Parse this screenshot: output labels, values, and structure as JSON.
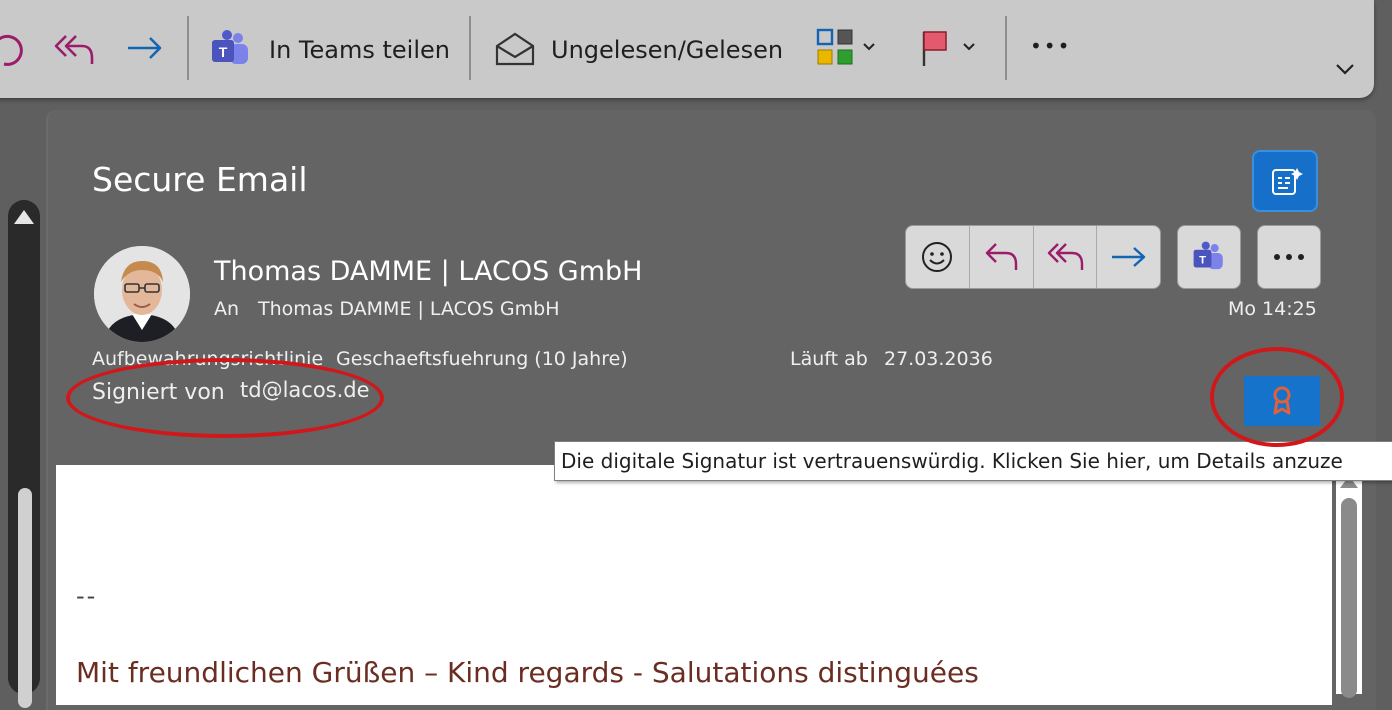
{
  "toolbar": {
    "teams_share_label": "In Teams teilen",
    "unread_read_label": "Ungelesen/Gelesen",
    "more_label": "•••"
  },
  "message": {
    "subject": "Secure Email",
    "sender": "Thomas DAMME | LACOS GmbH",
    "to_label": "An",
    "to_value": "Thomas DAMME | LACOS GmbH",
    "time": "Mo 14:25",
    "retention_label": "Aufbewahrungsrichtlinie",
    "retention_value": "Geschaeftsfuehrung (10 Jahre)",
    "expires_label": "Läuft ab",
    "expires_value": "27.03.2036",
    "signed_label": "Signiert von",
    "signed_value": "td@lacos.de"
  },
  "tooltip": {
    "text": "Die digitale Signatur ist vertrauenswürdig. Klicken Sie hier, um Details anzuze"
  },
  "body": {
    "separator": "--",
    "greeting": "Mit freundlichen Grüßen – Kind regards - Salutations distinguées"
  },
  "colors": {
    "reply_arrow": "#9c1c6b",
    "forward_arrow": "#1464b4",
    "accent_blue": "#1670c9",
    "annotation_red": "#d0181b",
    "signature_text": "#6b2d22"
  }
}
